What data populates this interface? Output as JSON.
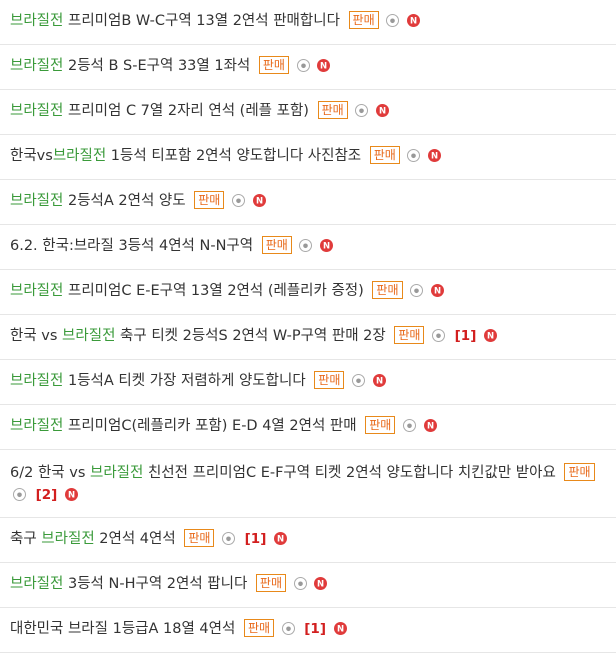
{
  "badge_label": "판매",
  "colors": {
    "highlight": "#3a9a3a",
    "badge_border": "#e8891a",
    "new_icon": "#e03b3b",
    "count": "#d21f1f"
  },
  "icons": {
    "photo": "camera-icon",
    "new": "new-icon"
  },
  "rows": [
    {
      "pre": "",
      "hl": "브라질전",
      "post": " 프리미엄B W-C구역 13열 2연석 판매합니다",
      "count": ""
    },
    {
      "pre": "",
      "hl": "브라질전",
      "post": " 2등석 B S-E구역 33열 1좌석",
      "count": ""
    },
    {
      "pre": "",
      "hl": "브라질전",
      "post": " 프리미엄 C 7열 2자리 연석 (레플 포함)",
      "count": ""
    },
    {
      "pre": "한국vs",
      "hl": "브라질전",
      "post": " 1등석 티포함 2연석 양도합니다 사진참조",
      "count": ""
    },
    {
      "pre": "",
      "hl": "브라질전",
      "post": " 2등석A 2연석 양도",
      "count": ""
    },
    {
      "pre": "6.2. 한국:브라질 3등석 4연석 N-N구역",
      "hl": "",
      "post": "",
      "count": ""
    },
    {
      "pre": "",
      "hl": "브라질전",
      "post": " 프리미엄C E-E구역 13열 2연석 (레플리카 증정)",
      "count": ""
    },
    {
      "pre": "한국 vs ",
      "hl": "브라질전",
      "post": " 축구 티켓 2등석S 2연석 W-P구역 판매 2장",
      "count": "[1]"
    },
    {
      "pre": "",
      "hl": "브라질전",
      "post": " 1등석A 티켓 가장 저렴하게 양도합니다",
      "count": ""
    },
    {
      "pre": "",
      "hl": "브라질전",
      "post": " 프리미엄C(레플리카 포함) E-D 4열 2연석 판매",
      "count": ""
    },
    {
      "pre": "6/2 한국 vs ",
      "hl": "브라질전",
      "post": " 친선전 프리미엄C E-F구역 티켓 2연석 양도합니다 치킨값만 받아요",
      "count": "[2]"
    },
    {
      "pre": "축구 ",
      "hl": "브라질전",
      "post": " 2연석 4연석",
      "count": "[1]"
    },
    {
      "pre": "",
      "hl": "브라질전",
      "post": " 3등석 N-H구역 2연석 팝니다",
      "count": ""
    },
    {
      "pre": "대한민국 브라질 1등급A 18열 4연석",
      "hl": "",
      "post": "",
      "count": "[1]"
    }
  ]
}
